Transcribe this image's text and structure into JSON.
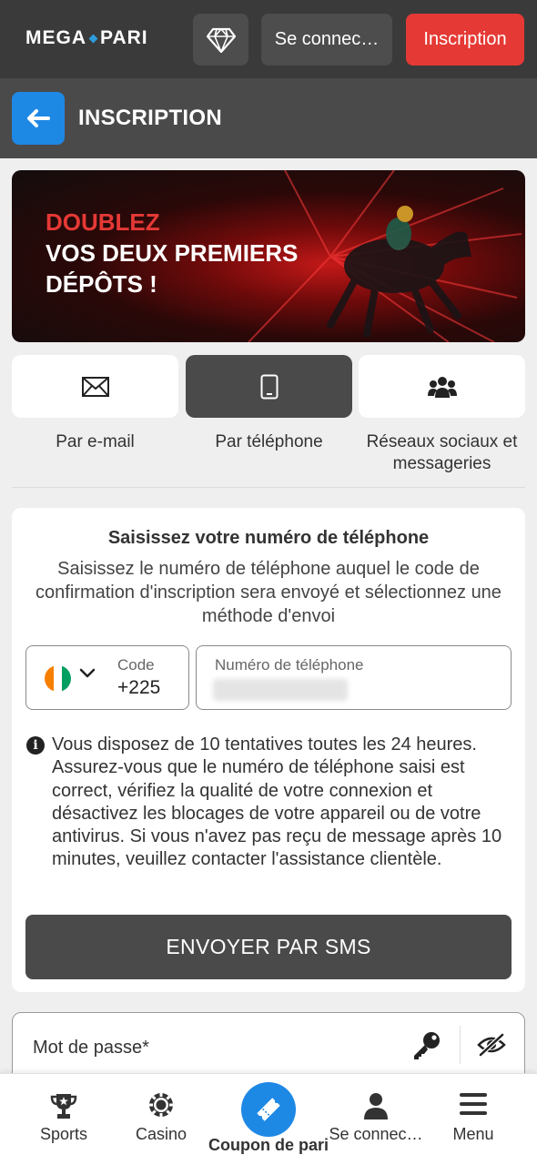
{
  "header": {
    "logo_text": [
      "MEGA",
      "PARI"
    ],
    "login_label": "Se connec…",
    "register_label": "Inscription"
  },
  "titlebar": {
    "title": "INSCRIPTION"
  },
  "banner": {
    "line1": "DOUBLEZ",
    "line2": "VOS DEUX PREMIERS",
    "line3": "DÉPÔTS !"
  },
  "methods": {
    "email_label": "Par e-mail",
    "phone_label": "Par téléphone",
    "social_label_1": "Réseaux sociaux et",
    "social_label_2": "messageries",
    "active": "phone"
  },
  "phone_form": {
    "title": "Saisissez votre numéro de téléphone",
    "subtitle": "Saisissez le numéro de téléphone auquel le code de confirmation d'inscription sera envoyé et sélectionnez une méthode d'envoi",
    "code_label": "Code",
    "code_value": "+225",
    "phone_label": "Numéro de téléphone",
    "info": "Vous disposez de 10 tentatives toutes les 24 heures. Assurez-vous que le numéro de téléphone saisi est correct, vérifiez la qualité de votre connexion et désactivez les blocages de votre appareil ou de votre antivirus. Si vous n'avez pas reçu de message après 10 minutes, veuillez contacter l'assistance clientèle.",
    "submit_label": "ENVOYER PAR SMS"
  },
  "password": {
    "label": "Mot de passe*"
  },
  "bottom_nav": {
    "sports": "Sports",
    "casino": "Casino",
    "coupon": "Coupon de pari",
    "login": "Se connec…",
    "menu": "Menu"
  },
  "colors": {
    "accent_red": "#e53935",
    "accent_blue": "#1e88e5",
    "dark_bg": "#3a3a3a"
  }
}
